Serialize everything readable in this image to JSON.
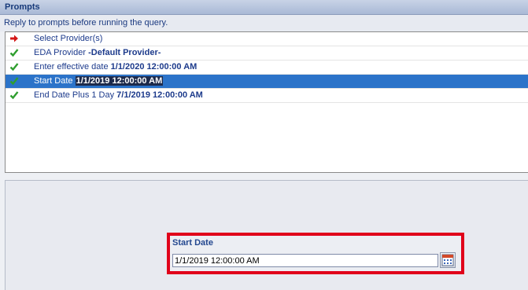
{
  "header": {
    "title": "Prompts"
  },
  "instructions": "Reply to prompts before running the query.",
  "prompts": [
    {
      "label": "Select Provider(s)",
      "value": "",
      "icon": "red-arrow-icon"
    },
    {
      "label": "EDA Provider ",
      "value": "-Default Provider-",
      "icon": "check-icon"
    },
    {
      "label": "Enter effective date ",
      "value": "1/1/2020 12:00:00 AM",
      "icon": "check-icon"
    },
    {
      "label": "Start Date ",
      "value": "1/1/2019 12:00:00 AM",
      "icon": "check-icon",
      "selected": true
    },
    {
      "label": "End Date Plus 1 Day ",
      "value": "7/1/2019 12:00:00 AM",
      "icon": "check-icon"
    }
  ],
  "editor": {
    "label": "Start Date",
    "value": "1/1/2019 12:00:00 AM",
    "calendar_icon": "calendar-icon"
  },
  "colors": {
    "selection": "#2b73c9",
    "highlight_border": "#e0001a",
    "check": "#2f9e2f",
    "arrow": "#d41818"
  }
}
